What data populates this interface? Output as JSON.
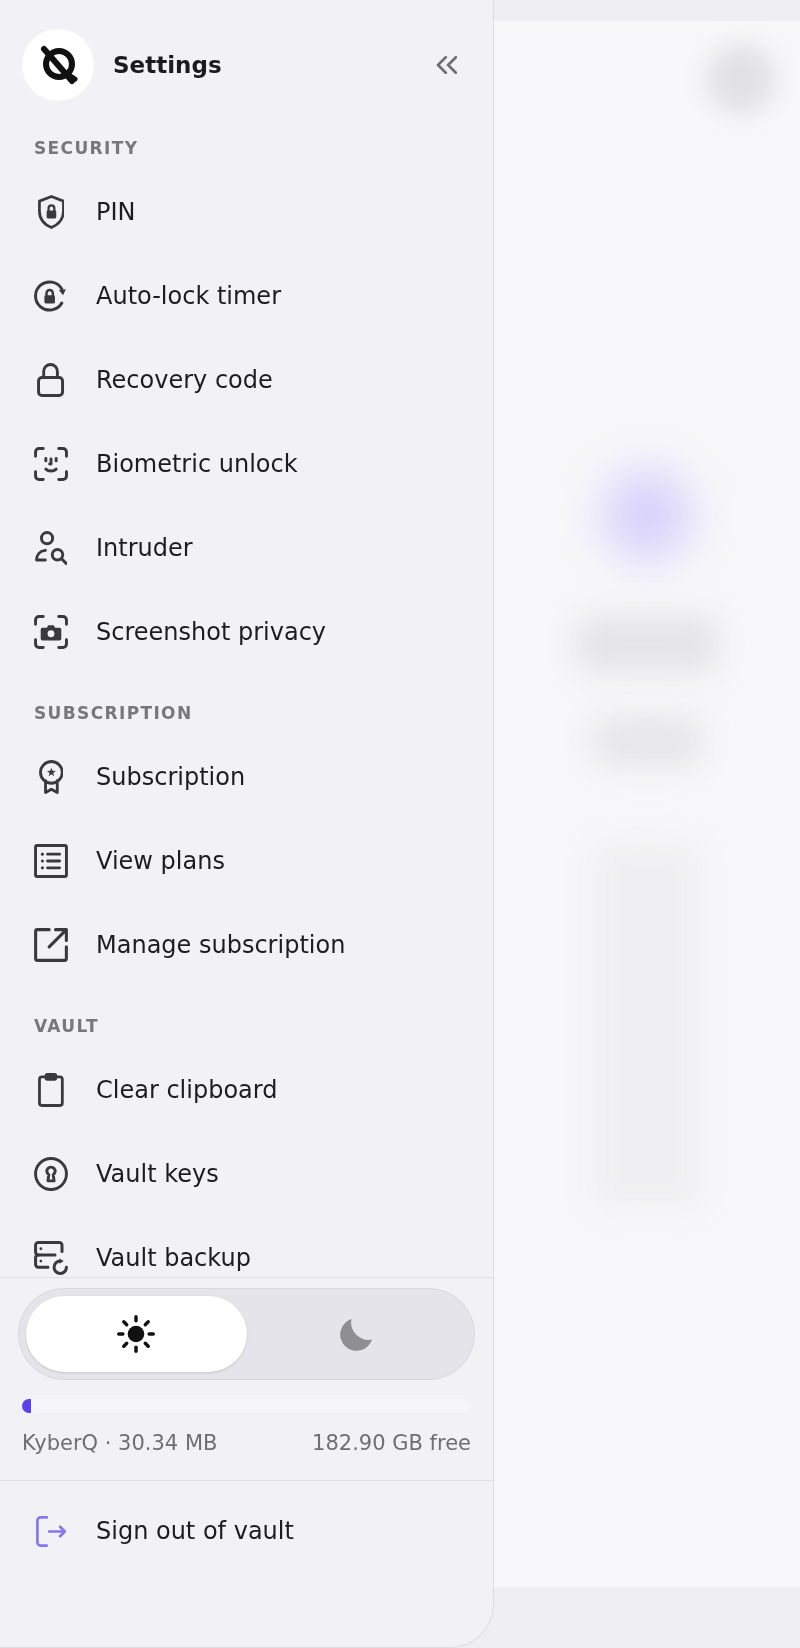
{
  "sidebar": {
    "title": "Settings",
    "sections": [
      {
        "heading": "SECURITY",
        "items": [
          {
            "label": "PIN"
          },
          {
            "label": "Auto-lock timer"
          },
          {
            "label": "Recovery code"
          },
          {
            "label": "Biometric unlock"
          },
          {
            "label": "Intruder"
          },
          {
            "label": "Screenshot privacy"
          }
        ]
      },
      {
        "heading": "SUBSCRIPTION",
        "items": [
          {
            "label": "Subscription"
          },
          {
            "label": "View plans"
          },
          {
            "label": "Manage subscription"
          }
        ]
      },
      {
        "heading": "VAULT",
        "items": [
          {
            "label": "Clear clipboard"
          },
          {
            "label": "Vault keys"
          },
          {
            "label": "Vault backup"
          }
        ]
      }
    ],
    "theme_toggle": {
      "options": [
        {
          "selected": true
        },
        {
          "selected": false
        }
      ]
    },
    "storage": {
      "level": 0.02,
      "used": "KyberQ · 30.34 MB",
      "free": "182.90 GB free"
    },
    "sign_out": {
      "label": "Sign out of vault"
    }
  }
}
